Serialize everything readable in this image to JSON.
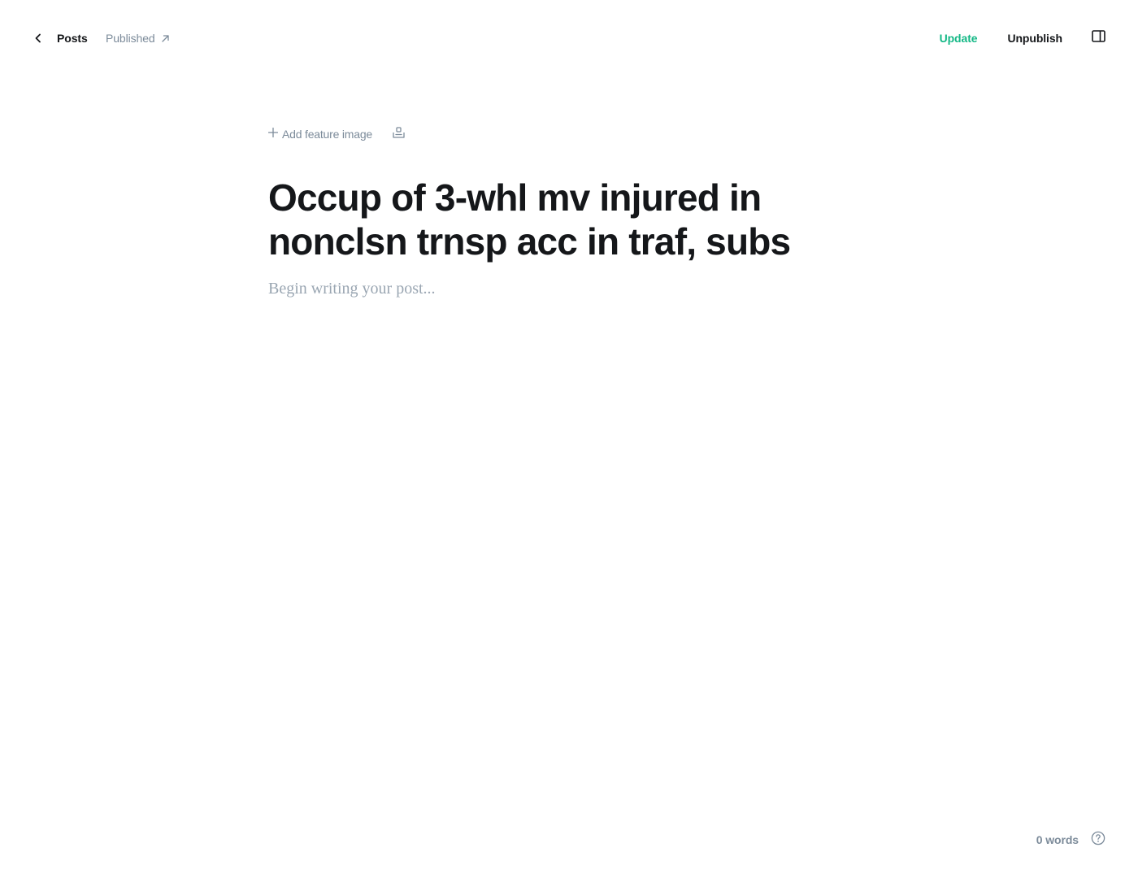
{
  "header": {
    "back_label": "Posts",
    "status_label": "Published",
    "update_label": "Update",
    "unpublish_label": "Unpublish"
  },
  "icons": {
    "back": "chevron-left-icon",
    "status_link": "external-link-arrow-icon",
    "sidebar": "sidebar-panel-icon",
    "add": "plus-icon",
    "snippet": "snippet-icon",
    "help": "question-circle-icon"
  },
  "editor": {
    "add_feature_label": "Add feature image",
    "title": "Occup of 3-whl mv injured in nonclsn trnsp acc in traf, subs",
    "body_placeholder": "Begin writing your post..."
  },
  "footer": {
    "word_count": "0 words"
  },
  "colors": {
    "text": "#15171a",
    "muted": "#7c8b9a",
    "accent": "#14b886",
    "placeholder": "#9aa6b2",
    "background": "#ffffff"
  }
}
